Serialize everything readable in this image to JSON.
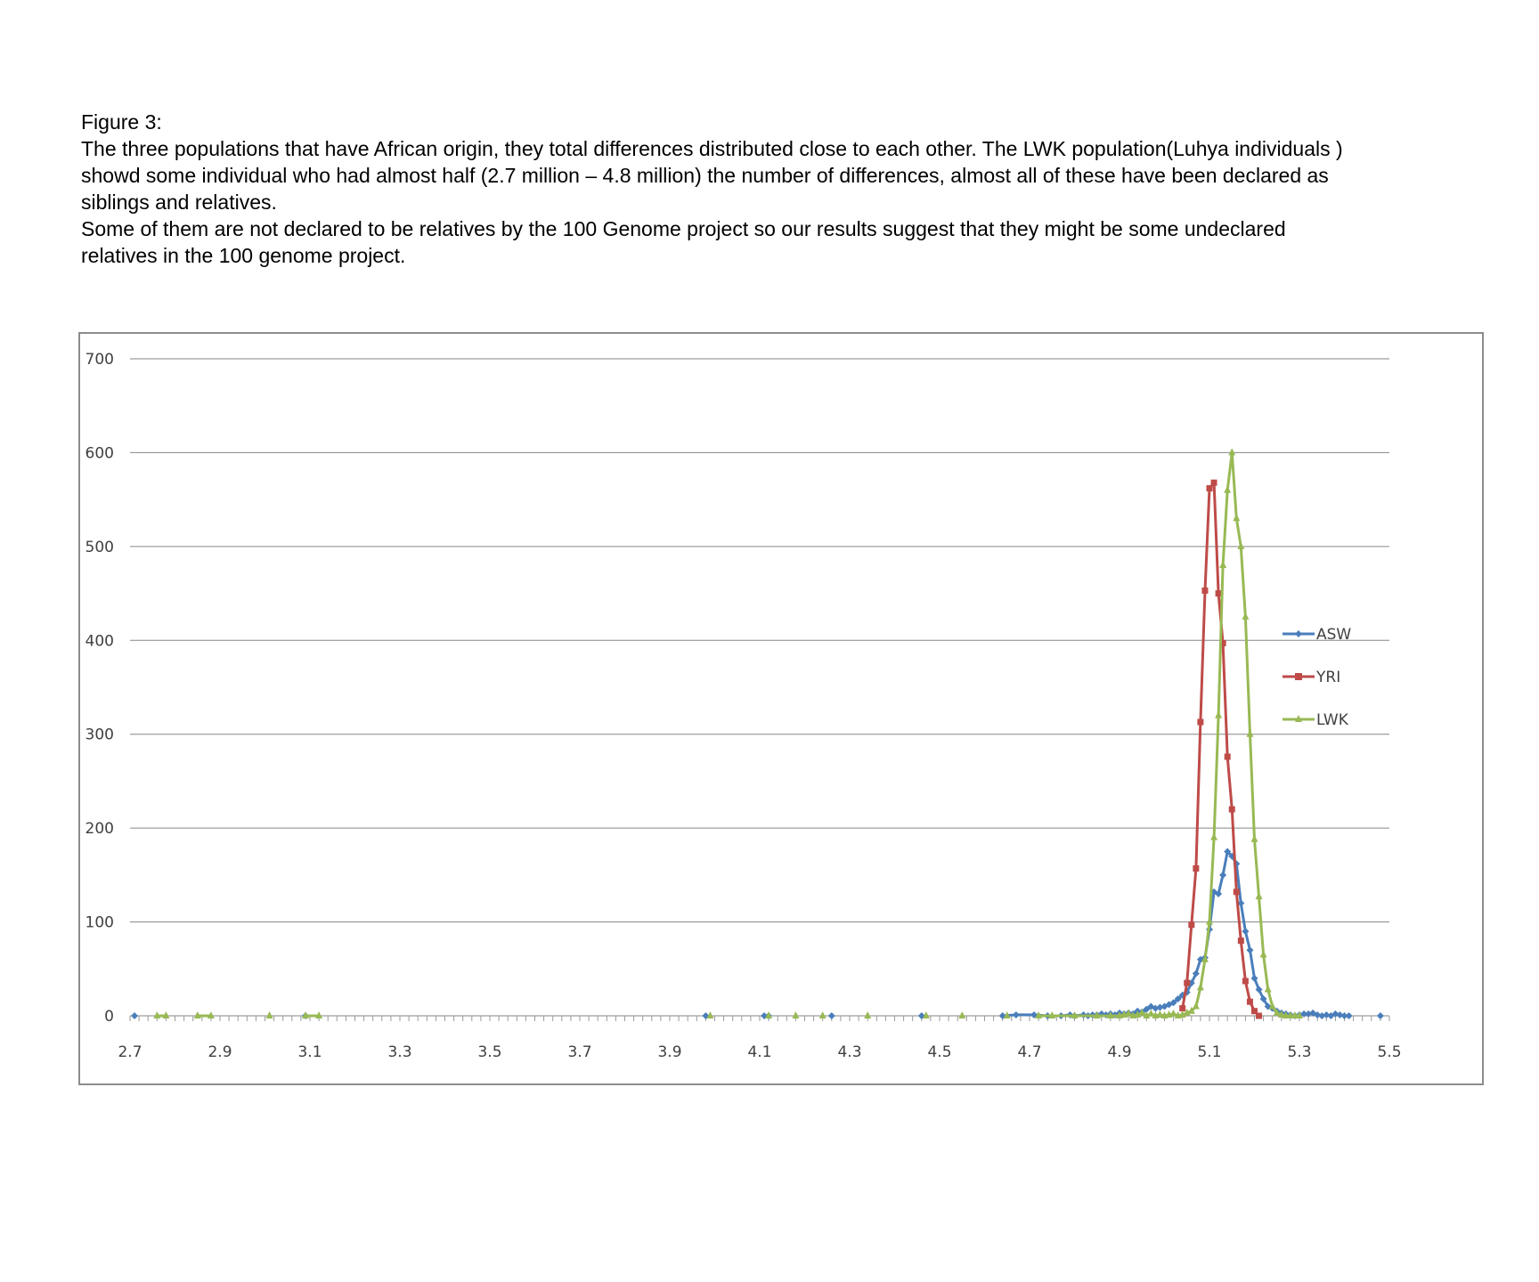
{
  "caption": {
    "heading": "Figure 3:",
    "paragraph1_line1": "The three populations that have African origin, they total differences distributed close to each other. The LWK population(Luhya individuals )",
    "paragraph1_line2": "showd some individual who had almost half (2.7 million – 4.8 million)  the number of differences, almost  all of these have been declared as",
    "paragraph1_line3": "siblings and relatives.",
    "paragraph2_line1": "Some of them are not declared to be relatives by the 100 Genome project so our results suggest that they might be some undeclared",
    "paragraph2_line2": "relatives in the 100 genome project."
  },
  "chart_data": {
    "type": "line",
    "title": "",
    "xlabel": "",
    "ylabel": "",
    "xlim": [
      2.7,
      5.5
    ],
    "ylim": [
      0,
      700
    ],
    "x_ticks": [
      "2.7",
      "2.9",
      "3.1",
      "3.3",
      "3.5",
      "3.7",
      "3.9",
      "4.1",
      "4.3",
      "4.5",
      "4.7",
      "4.9",
      "5.1",
      "5.3",
      "5.5"
    ],
    "y_ticks": [
      "0",
      "100",
      "200",
      "300",
      "400",
      "500",
      "600",
      "700"
    ],
    "grid": "horizontal",
    "legend_position": "right",
    "series": [
      {
        "name": "ASW",
        "color": "#4a7ebb",
        "marker": "diamond",
        "x": [
          2.71,
          3.09,
          3.98,
          4.11,
          4.12,
          4.26,
          4.46,
          4.64,
          4.67,
          4.71,
          4.74,
          4.77,
          4.79,
          4.8,
          4.82,
          4.83,
          4.84,
          4.85,
          4.86,
          4.87,
          4.88,
          4.89,
          4.9,
          4.91,
          4.92,
          4.93,
          4.94,
          4.95,
          4.96,
          4.97,
          4.98,
          4.99,
          5.0,
          5.01,
          5.02,
          5.03,
          5.04,
          5.05,
          5.06,
          5.07,
          5.08,
          5.09,
          5.1,
          5.11,
          5.12,
          5.13,
          5.14,
          5.15,
          5.16,
          5.17,
          5.18,
          5.19,
          5.2,
          5.21,
          5.22,
          5.23,
          5.24,
          5.25,
          5.26,
          5.27,
          5.28,
          5.29,
          5.3,
          5.31,
          5.32,
          5.33,
          5.34,
          5.35,
          5.36,
          5.37,
          5.38,
          5.39,
          5.4,
          5.41,
          5.48
        ],
        "y": [
          0,
          0,
          0,
          0,
          0,
          0,
          0,
          0,
          1,
          1,
          0,
          0,
          1,
          0,
          1,
          0,
          1,
          1,
          2,
          1,
          2,
          1,
          3,
          2,
          3,
          2,
          5,
          4,
          7,
          10,
          8,
          9,
          10,
          12,
          14,
          18,
          22,
          25,
          35,
          45,
          60,
          62,
          92,
          132,
          130,
          150,
          175,
          170,
          162,
          120,
          90,
          70,
          40,
          28,
          18,
          10,
          8,
          5,
          3,
          2,
          1,
          0,
          1,
          2,
          2,
          3,
          1,
          0,
          1,
          0,
          2,
          1,
          0,
          0,
          0
        ]
      },
      {
        "name": "YRI",
        "color": "#be4b48",
        "marker": "square",
        "x": [
          5.04,
          5.05,
          5.06,
          5.07,
          5.08,
          5.09,
          5.1,
          5.11,
          5.12,
          5.13,
          5.14,
          5.15,
          5.16,
          5.17,
          5.18,
          5.19,
          5.2,
          5.21
        ],
        "y": [
          8,
          35,
          97,
          157,
          313,
          453,
          562,
          568,
          450,
          397,
          276,
          220,
          132,
          80,
          37,
          15,
          5,
          0
        ]
      },
      {
        "name": "LWK",
        "color": "#98b954",
        "marker": "triangle",
        "x": [
          2.76,
          2.78,
          2.85,
          2.88,
          3.01,
          3.09,
          3.12,
          3.99,
          4.12,
          4.18,
          4.24,
          4.34,
          4.47,
          4.55,
          4.65,
          4.72,
          4.75,
          4.8,
          4.85,
          4.88,
          4.9,
          4.91,
          4.92,
          4.93,
          4.94,
          4.95,
          4.96,
          4.97,
          4.98,
          4.99,
          5.0,
          5.01,
          5.02,
          5.03,
          5.04,
          5.05,
          5.06,
          5.07,
          5.08,
          5.09,
          5.1,
          5.11,
          5.12,
          5.13,
          5.14,
          5.15,
          5.16,
          5.17,
          5.18,
          5.19,
          5.2,
          5.21,
          5.22,
          5.23,
          5.24,
          5.25,
          5.26,
          5.27,
          5.28,
          5.29,
          5.3
        ],
        "y": [
          0,
          0,
          0,
          0,
          0,
          0,
          0,
          0,
          0,
          0,
          0,
          0,
          0,
          0,
          0,
          0,
          0,
          0,
          0,
          0,
          0,
          1,
          2,
          0,
          1,
          3,
          0,
          2,
          0,
          1,
          0,
          1,
          2,
          0,
          1,
          3,
          5,
          10,
          30,
          60,
          100,
          190,
          320,
          480,
          560,
          600,
          530,
          500,
          425,
          300,
          188,
          127,
          65,
          28,
          10,
          3,
          1,
          0,
          0,
          0,
          0
        ]
      }
    ]
  }
}
